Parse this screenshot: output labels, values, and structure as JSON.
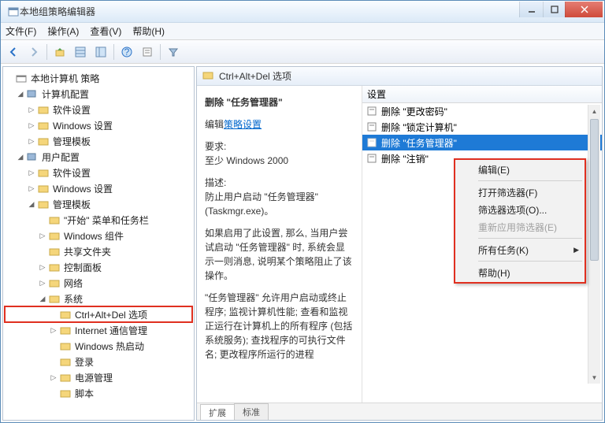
{
  "window": {
    "title": "本地组策略编辑器"
  },
  "menu": {
    "file": "文件(F)",
    "action": "操作(A)",
    "view": "查看(V)",
    "help": "帮助(H)"
  },
  "toolbar_icons": [
    "back",
    "forward",
    "up",
    "list",
    "detail",
    "sep",
    "help",
    "props",
    "sep",
    "filter"
  ],
  "tree": {
    "root": "本地计算机 策略",
    "computer_cfg": "计算机配置",
    "software_settings": "软件设置",
    "windows_settings": "Windows 设置",
    "admin_templates": "管理模板",
    "user_cfg": "用户配置",
    "start_menu": "\"开始\" 菜单和任务栏",
    "windows_components": "Windows 组件",
    "shared_folders": "共享文件夹",
    "control_panel": "控制面板",
    "network": "网络",
    "system": "系统",
    "ctrl_alt_del": "Ctrl+Alt+Del 选项",
    "internet_mgmt": "Internet 通信管理",
    "windows_hotstart": "Windows 热启动",
    "logon": "登录",
    "power_mgmt": "电源管理",
    "scripts": "脚本"
  },
  "right": {
    "header": "Ctrl+Alt+Del 选项",
    "title": "删除 \"任务管理器\"",
    "edit_prefix": "编辑",
    "edit_link": "策略设置",
    "req_label": "要求:",
    "req_value": "至少 Windows 2000",
    "desc_label": "描述:",
    "desc_1": "防止用户启动 \"任务管理器\" (Taskmgr.exe)。",
    "desc_2": "如果启用了此设置, 那么, 当用户尝试启动 \"任务管理器\" 时, 系统会显示一则消息, 说明某个策略阻止了该操作。",
    "desc_3": "\"任务管理器\" 允许用户启动或终止程序; 监视计算机性能; 查看和监视正运行在计算机上的所有程序 (包括系统服务); 查找程序的可执行文件名; 更改程序所运行的进程",
    "col_settings": "设置",
    "items": [
      "删除 \"更改密码\"",
      "删除 \"锁定计算机\"",
      "删除 \"任务管理器\"",
      "删除 \"注销\""
    ],
    "tab_ext": "扩展",
    "tab_std": "标准"
  },
  "ctx": {
    "edit": "编辑(E)",
    "open_filter": "打开筛选器(F)",
    "filter_options": "筛选器选项(O)...",
    "reapply_filter": "重新应用筛选器(E)",
    "all_tasks": "所有任务(K)",
    "help": "帮助(H)"
  }
}
